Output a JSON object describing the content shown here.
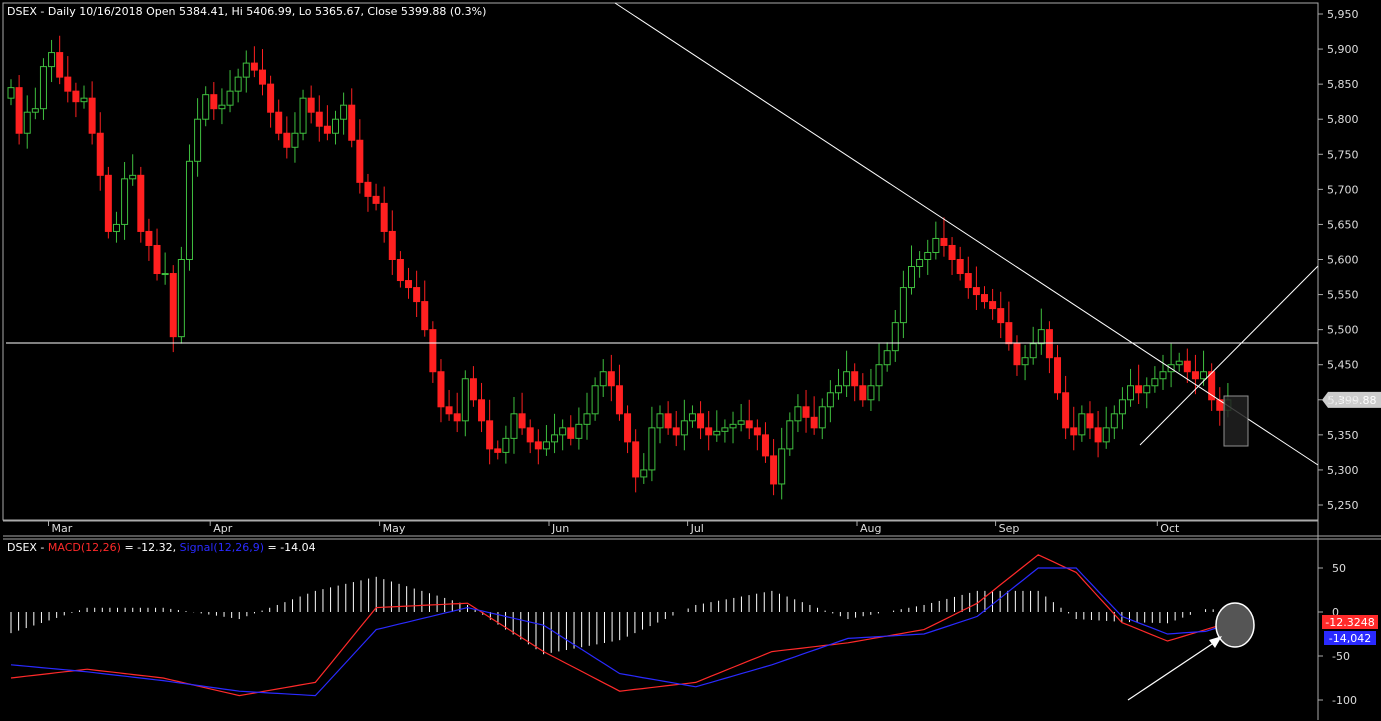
{
  "chart_data": [
    {
      "type": "candlestick",
      "title": "DSEX - Daily 10/16/2018 Open 5384.41, Hi 5406.99, Lo 5365.67, Close 5399.88 (0.3%)",
      "ylim": [
        5240,
        5960
      ],
      "yticks": [
        "5,950",
        "5,900",
        "5,850",
        "5,800",
        "5,750",
        "5,700",
        "5,650",
        "5,600",
        "5,550",
        "5,500",
        "5,450",
        "5,400",
        "5,350",
        "5,300",
        "5,250"
      ],
      "ytick_values": [
        5950,
        5900,
        5850,
        5800,
        5750,
        5700,
        5650,
        5600,
        5550,
        5500,
        5450,
        5400,
        5350,
        5300,
        5250
      ],
      "months": [
        {
          "label": "Mar",
          "index": 5
        },
        {
          "label": "Apr",
          "index": 26
        },
        {
          "label": "May",
          "index": 48
        },
        {
          "label": "Jun",
          "index": 70
        },
        {
          "label": "Jul",
          "index": 88
        },
        {
          "label": "Aug",
          "index": 110
        },
        {
          "label": "Sep",
          "index": 128
        },
        {
          "label": "Oct",
          "index": 149
        }
      ],
      "candles_close": [
        5845,
        5780,
        5810,
        5815,
        5875,
        5895,
        5860,
        5840,
        5825,
        5830,
        5780,
        5720,
        5640,
        5650,
        5715,
        5720,
        5640,
        5620,
        5580,
        5580,
        5490,
        5600,
        5740,
        5800,
        5835,
        5815,
        5820,
        5840,
        5860,
        5880,
        5870,
        5850,
        5810,
        5780,
        5760,
        5780,
        5830,
        5810,
        5790,
        5780,
        5800,
        5820,
        5770,
        5710,
        5690,
        5680,
        5640,
        5600,
        5570,
        5560,
        5540,
        5500,
        5440,
        5390,
        5380,
        5370,
        5430,
        5400,
        5370,
        5330,
        5325,
        5345,
        5380,
        5360,
        5340,
        5330,
        5340,
        5350,
        5360,
        5345,
        5365,
        5380,
        5420,
        5440,
        5420,
        5380,
        5340,
        5290,
        5300,
        5360,
        5380,
        5360,
        5350,
        5370,
        5380,
        5360,
        5350,
        5355,
        5360,
        5365,
        5370,
        5360,
        5350,
        5320,
        5280,
        5330,
        5370,
        5390,
        5375,
        5360,
        5390,
        5410,
        5420,
        5440,
        5420,
        5400,
        5420,
        5450,
        5470,
        5510,
        5560,
        5590,
        5600,
        5610,
        5630,
        5620,
        5600,
        5580,
        5560,
        5550,
        5540,
        5530,
        5510,
        5480,
        5450,
        5460,
        5480,
        5500,
        5460,
        5410,
        5360,
        5350,
        5380,
        5360,
        5340,
        5360,
        5380,
        5400,
        5420,
        5410,
        5420,
        5430,
        5440,
        5450,
        5455,
        5440,
        5430,
        5440,
        5400,
        5385,
        5399.88
      ],
      "last_close_label": "5,399.88",
      "ref_line": 5481
    },
    {
      "type": "line",
      "title_prefix": "DSEX - ",
      "macd_label": "MACD(12,26)",
      "macd_value": " = -12.32, ",
      "signal_label": "Signal(12,26,9)",
      "signal_value": " = -14.04",
      "ylim": [
        -115,
        80
      ],
      "yticks": [
        "50",
        "0",
        "-50",
        "-100"
      ],
      "ytick_values": [
        50,
        0,
        -50,
        -100
      ],
      "x": [
        0,
        10,
        20,
        30,
        40,
        48,
        60,
        70,
        80,
        90,
        100,
        110,
        120,
        127,
        135,
        140,
        146,
        152,
        157,
        160
      ],
      "series": [
        {
          "name": "MACD",
          "color": "#ff2a2a",
          "values": [
            -75,
            -65,
            -75,
            -95,
            -80,
            5,
            10,
            -45,
            -90,
            -80,
            -45,
            -35,
            -20,
            10,
            65,
            45,
            -12,
            -33,
            -20,
            -12.32
          ]
        },
        {
          "name": "Signal",
          "color": "#2a2aff",
          "values": [
            -60,
            -68,
            -78,
            -90,
            -95,
            -20,
            5,
            -15,
            -70,
            -85,
            -60,
            -30,
            -25,
            -5,
            50,
            50,
            -5,
            -25,
            -22,
            -14.04
          ]
        }
      ],
      "macd_tag": "-12.3248",
      "signal_tag": "-14,042",
      "macd_color": "#ff2a2a",
      "signal_color": "#2a2aff"
    }
  ]
}
